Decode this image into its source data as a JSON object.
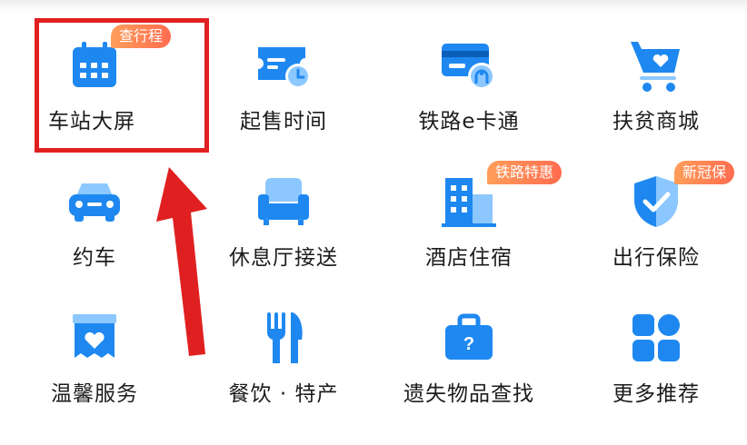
{
  "colors": {
    "icon_blue": "#1e88f0",
    "icon_light": "#8cc8ff",
    "badge_start": "#ff9e5a",
    "badge_end": "#ff6c4f",
    "annotation_red": "#e02020"
  },
  "items": [
    {
      "label": "车站大屏",
      "icon": "calendar-icon",
      "badge": "查行程"
    },
    {
      "label": "起售时间",
      "icon": "ticket-clock-icon",
      "badge": ""
    },
    {
      "label": "铁路e卡通",
      "icon": "rail-card-icon",
      "badge": ""
    },
    {
      "label": "扶贫商城",
      "icon": "shopping-cart-icon",
      "badge": ""
    },
    {
      "label": "约车",
      "icon": "car-icon",
      "badge": ""
    },
    {
      "label": "休息厅接送",
      "icon": "sofa-icon",
      "badge": ""
    },
    {
      "label": "酒店住宿",
      "icon": "hotel-building-icon",
      "badge": "铁路特惠"
    },
    {
      "label": "出行保险",
      "icon": "shield-icon",
      "badge": "新冠保"
    },
    {
      "label": "温馨服务",
      "icon": "heart-box-icon",
      "badge": ""
    },
    {
      "label": "餐饮 · 特产",
      "icon": "fork-knife-icon",
      "badge": ""
    },
    {
      "label": "遗失物品查找",
      "icon": "lost-bag-icon",
      "badge": ""
    },
    {
      "label": "更多推荐",
      "icon": "more-grid-icon",
      "badge": ""
    }
  ]
}
